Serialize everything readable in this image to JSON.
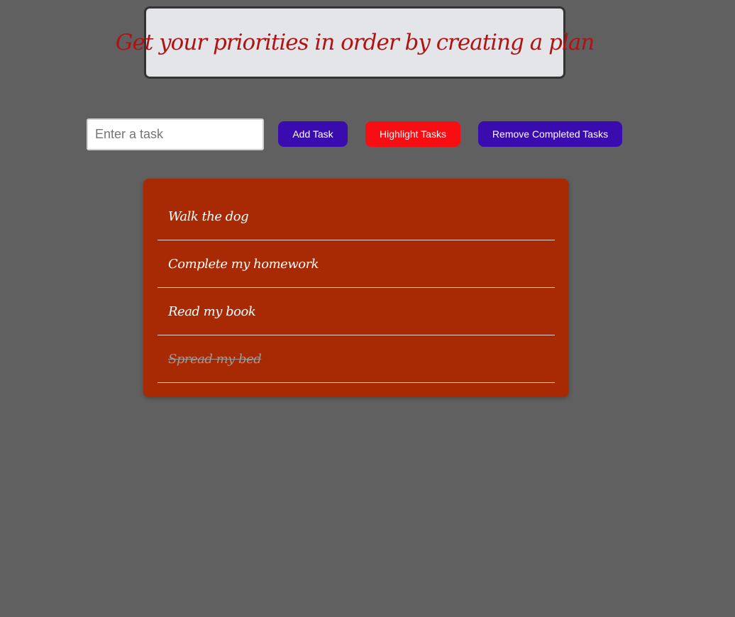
{
  "header": {
    "title": "Get your priorities in order by creating a plan"
  },
  "controls": {
    "input_placeholder": "Enter a task",
    "input_value": "",
    "add_label": "Add Task",
    "highlight_label": "Highlight Tasks",
    "remove_label": "Remove Completed Tasks"
  },
  "tasks": [
    {
      "text": "Walk the dog",
      "completed": false
    },
    {
      "text": "Complete my homework",
      "completed": false
    },
    {
      "text": "Read my book",
      "completed": false
    },
    {
      "text": "Spread my bed",
      "completed": true
    }
  ],
  "colors": {
    "background": "#606060",
    "title_text": "#b01313",
    "primary_button": "#3a0caf",
    "highlight_button": "#f80d12",
    "panel": "#a82a05"
  }
}
